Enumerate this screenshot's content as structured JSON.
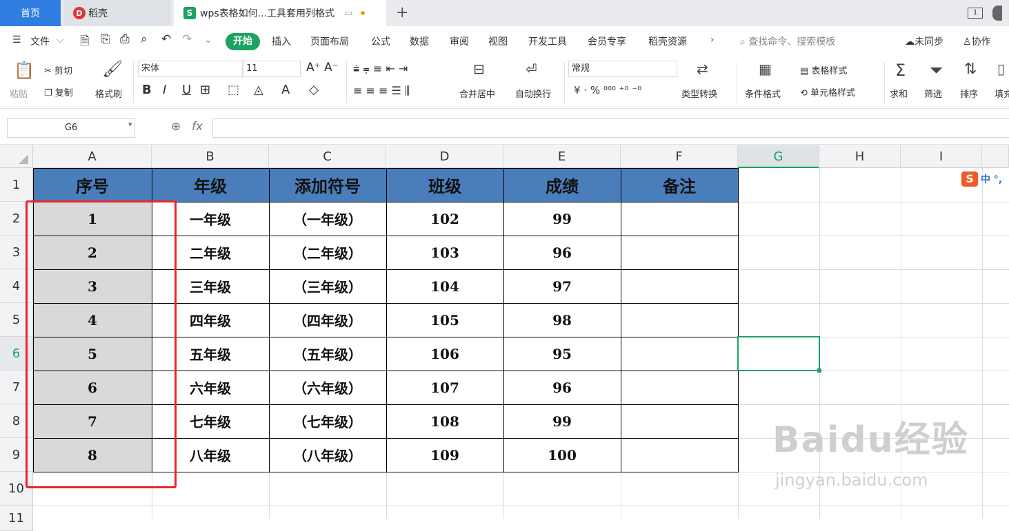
{
  "tabs": {
    "home": "首页",
    "daoke": "稻壳",
    "doc": "wps表格如何...工具套用列格式"
  },
  "menu": {
    "file": "文件",
    "items": [
      "开始",
      "插入",
      "页面布局",
      "公式",
      "数据",
      "审阅",
      "视图",
      "开发工具",
      "会员专享",
      "稻壳资源"
    ],
    "search": "查找命令、搜索模板",
    "sync": "未同步",
    "collab": "协作"
  },
  "toolbar": {
    "paste": "粘贴",
    "cut": "剪切",
    "copy": "复制",
    "format_painter": "格式刷",
    "font_name": "宋体",
    "font_size": "11",
    "merge_center": "合并居中",
    "wrap": "自动换行",
    "number_format": "常规",
    "type_convert": "类型转换",
    "cond_format": "条件格式",
    "table_style": "表格样式",
    "cell_style": "单元格样式",
    "sum": "求和",
    "filter": "筛选",
    "sort": "排序",
    "fill": "填充"
  },
  "formula": {
    "namebox": "G6",
    "fx": "fx"
  },
  "columns": [
    "A",
    "B",
    "C",
    "D",
    "E",
    "F",
    "G",
    "H",
    "I"
  ],
  "rows": [
    "1",
    "2",
    "3",
    "4",
    "5",
    "6",
    "7",
    "8",
    "9",
    "10",
    "11"
  ],
  "table": {
    "header": [
      "序号",
      "年级",
      "添加符号",
      "班级",
      "成绩",
      "备注"
    ],
    "rows": [
      [
        "1",
        "一年级",
        "（一年级）",
        "102",
        "99",
        ""
      ],
      [
        "2",
        "二年级",
        "（二年级）",
        "103",
        "96",
        ""
      ],
      [
        "3",
        "三年级",
        "（三年级）",
        "104",
        "97",
        ""
      ],
      [
        "4",
        "四年级",
        "（四年级）",
        "105",
        "98",
        ""
      ],
      [
        "5",
        "五年级",
        "（五年级）",
        "106",
        "95",
        ""
      ],
      [
        "6",
        "六年级",
        "（六年级）",
        "107",
        "96",
        ""
      ],
      [
        "7",
        "七年级",
        "（七年级）",
        "108",
        "99",
        ""
      ],
      [
        "8",
        "八年级",
        "（八年级）",
        "109",
        "100",
        ""
      ]
    ]
  },
  "ime": "中 °,",
  "watermark": {
    "text": "Baidu经验",
    "url": "jingyan.baidu.com"
  },
  "colors": {
    "accent": "#1aa361",
    "header_fill": "#4a7ebb",
    "seq_fill": "#d9d9d9",
    "red_box": "#e8262a"
  }
}
